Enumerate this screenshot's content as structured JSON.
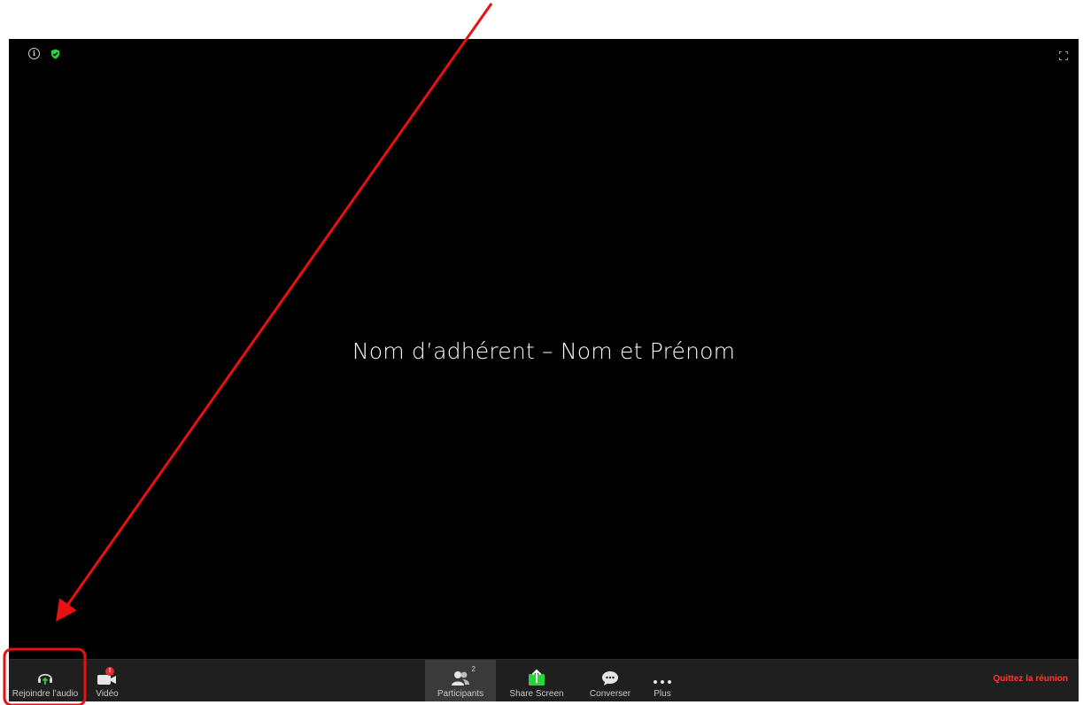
{
  "meeting": {
    "participant_display_name": "Nom d’adhérent – Nom et Prénom"
  },
  "icons": {
    "info": "info-icon",
    "shield": "shield-check-icon",
    "fullscreen": "fullscreen-icon"
  },
  "toolbar": {
    "audio_label": "Rejoindre l’audio",
    "video_label": "Vidéo",
    "video_badge": "!",
    "participants_label": "Participants",
    "participants_count": "2",
    "share_label": "Share Screen",
    "chat_label": "Converser",
    "more_label": "Plus",
    "leave_label": "Quittez la réunion"
  },
  "colors": {
    "background": "#000000",
    "toolbar": "#1f1f1f",
    "accent_green": "#2bd23a",
    "leave_red": "#ff3b30",
    "annotation_red": "#e81010"
  }
}
